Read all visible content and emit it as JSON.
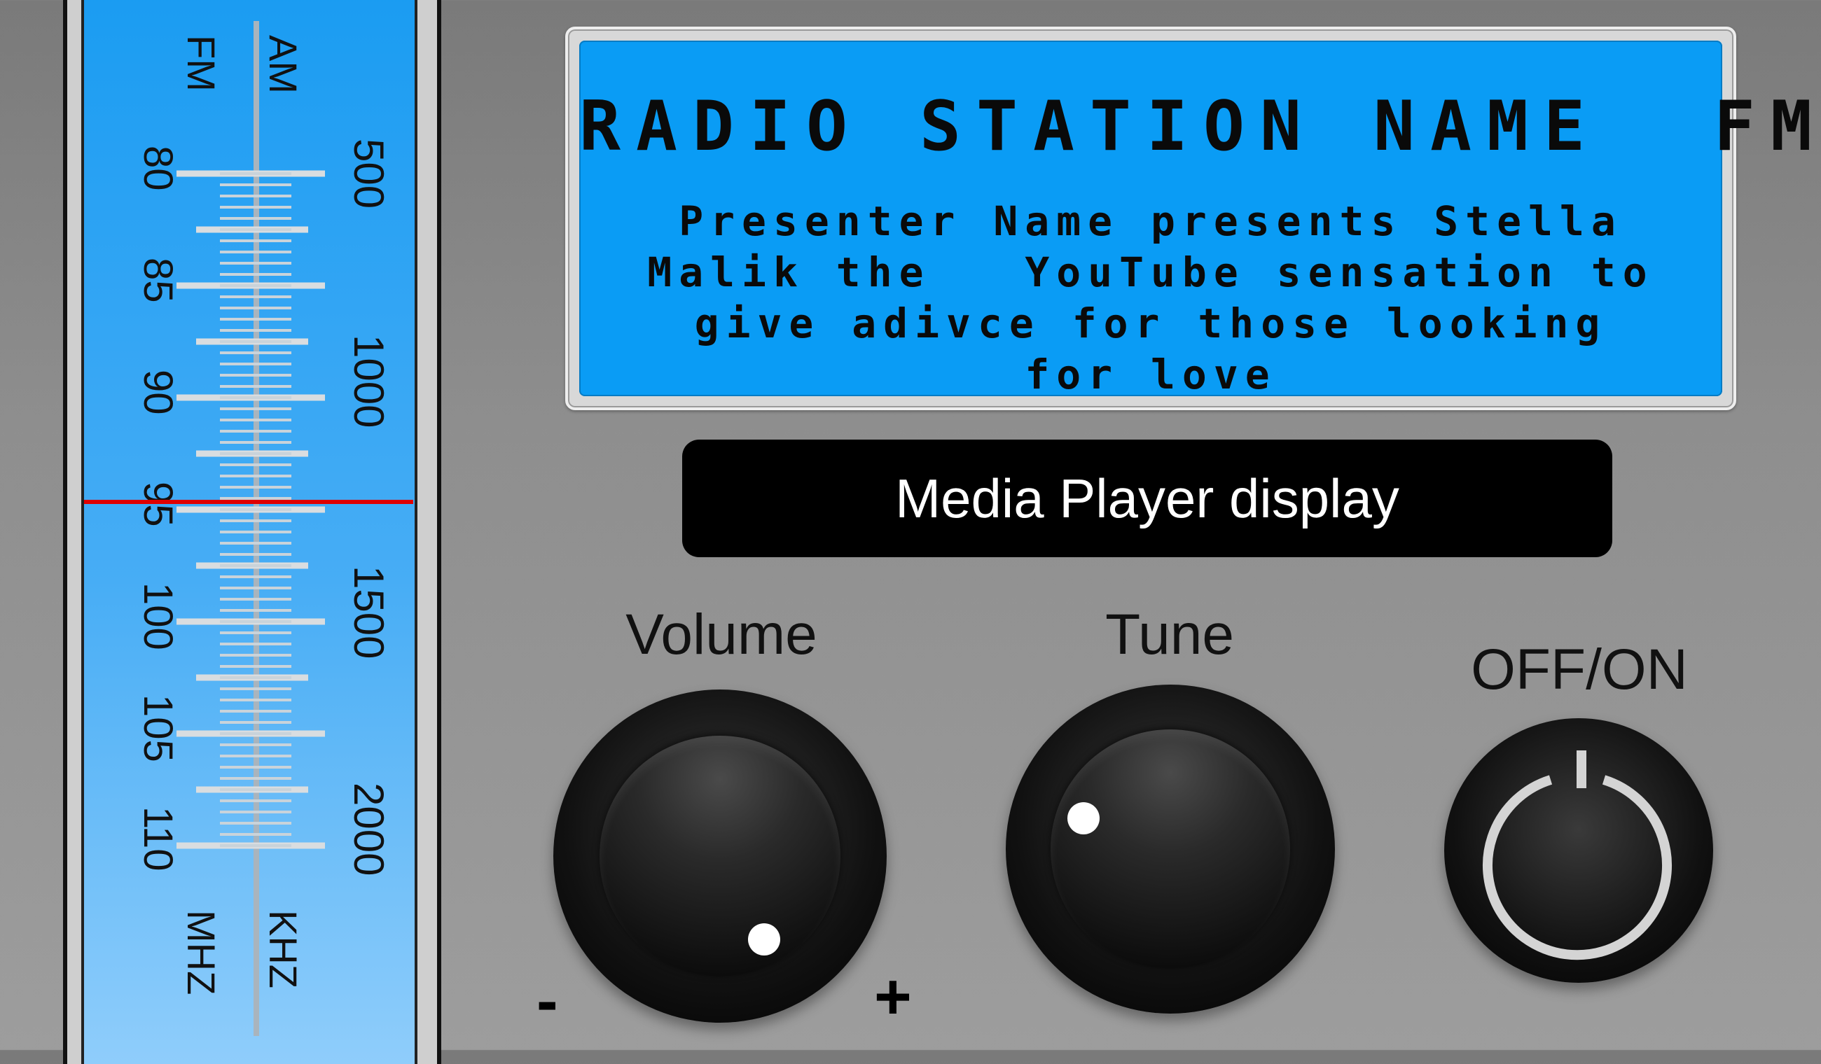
{
  "dial": {
    "fm_band_label": "FM",
    "am_band_label": "AM",
    "fm_unit": "MHZ",
    "am_unit": "KHZ",
    "fm_scale": [
      "80",
      "85",
      "90",
      "95",
      "100",
      "105",
      "110"
    ],
    "am_scale": [
      "500",
      "1000",
      "1500",
      "2000"
    ],
    "tuned_fm_value": 95,
    "needle_color": "#e00000"
  },
  "lcd": {
    "station_name": "RADIO STATION NAME  FM",
    "now_playing": "Presenter Name presents Stella\nMalik the   YouTube sensation to\ngive adivce for those looking\nfor love",
    "background_color": "#0a9cf5"
  },
  "media_player": {
    "label": "Media Player display"
  },
  "controls": {
    "volume_label": "Volume",
    "volume_min_label": "-",
    "volume_max_label": "+",
    "tune_label": "Tune",
    "power_label": "OFF/ON",
    "power_icon": "power-icon"
  }
}
